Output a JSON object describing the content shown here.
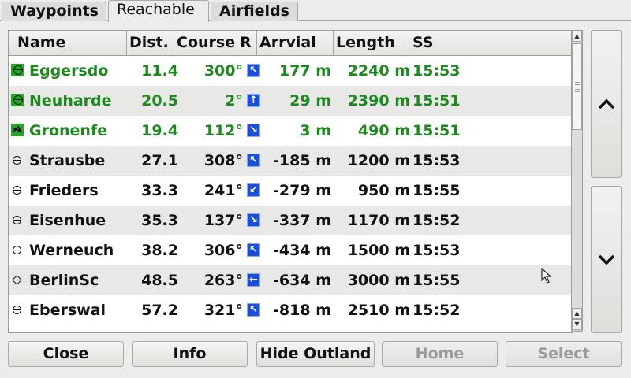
{
  "tabs": [
    {
      "label": "Waypoints"
    },
    {
      "label": "Reachable"
    },
    {
      "label": "Airfields"
    }
  ],
  "table": {
    "headers": [
      "Name",
      "Dist.",
      "Course",
      "R",
      "Arrvial",
      "Length",
      "SS"
    ],
    "rows": [
      {
        "icon": "green-landable-icon",
        "arrow": "↖",
        "name": "Eggersdo",
        "dist": "11.4",
        "course": "300°",
        "arrival": "177 m",
        "length": "2240 m",
        "ss": "15:53",
        "color": "#1d8a1d"
      },
      {
        "icon": "green-landable-icon",
        "arrow": "↑",
        "name": "Neuharde",
        "dist": "20.5",
        "course": "2°",
        "arrival": "29 m",
        "length": "2390 m",
        "ss": "15:51",
        "color": "#1d8a1d"
      },
      {
        "icon": "green-outlanding-icon",
        "arrow": "↘",
        "name": "Gronenfe",
        "dist": "19.4",
        "course": "112°",
        "arrival": "3 m",
        "length": "490 m",
        "ss": "15:51",
        "color": "#1d8a1d"
      },
      {
        "icon": "airfield-icon",
        "arrow": "↖",
        "name": "Strausbe",
        "dist": "27.1",
        "course": "308°",
        "arrival": "-185 m",
        "length": "1200 m",
        "ss": "15:53",
        "color": "#111111"
      },
      {
        "icon": "airfield-icon",
        "arrow": "↙",
        "name": "Frieders",
        "dist": "33.3",
        "course": "241°",
        "arrival": "-279 m",
        "length": "950 m",
        "ss": "15:55",
        "color": "#111111"
      },
      {
        "icon": "airfield-icon",
        "arrow": "↘",
        "name": "Eisenhue",
        "dist": "35.3",
        "course": "137°",
        "arrival": "-337 m",
        "length": "1170 m",
        "ss": "15:52",
        "color": "#111111"
      },
      {
        "icon": "airfield-icon",
        "arrow": "↖",
        "name": "Werneuch",
        "dist": "38.2",
        "course": "306°",
        "arrival": "-434 m",
        "length": "1500 m",
        "ss": "15:53",
        "color": "#111111"
      },
      {
        "icon": "airport-icon",
        "arrow": "←",
        "name": "BerlinSc",
        "dist": "48.5",
        "course": "263°",
        "arrival": "-634 m",
        "length": "3000 m",
        "ss": "15:55",
        "color": "#111111"
      },
      {
        "icon": "airfield-icon",
        "arrow": "↖",
        "name": "Eberswal",
        "dist": "57.2",
        "course": "321°",
        "arrival": "-818 m",
        "length": "2510 m",
        "ss": "15:52",
        "color": "#111111"
      }
    ]
  },
  "buttons": {
    "close": "Close",
    "info": "Info",
    "hide_outland": "Hide Outland",
    "home": "Home",
    "select": "Select"
  },
  "colors": {
    "reachable": "#1d8a1d",
    "unreachable": "#111111",
    "arrow_bg": "#1c4fd9"
  }
}
